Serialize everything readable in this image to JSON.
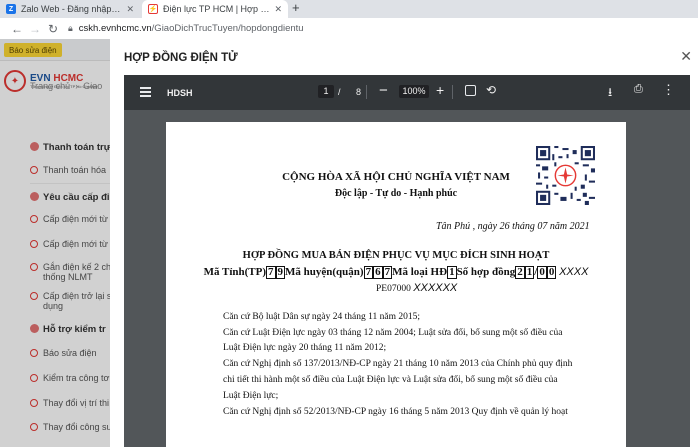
{
  "browser": {
    "tabs": [
      {
        "title": "Zalo Web - Đăng nhập Zalo",
        "icon": "zalo-icon"
      },
      {
        "title": "Điện lực TP HCM | Hợp đồng điện tử",
        "icon": "evn-icon"
      }
    ],
    "new_tab": "+",
    "url_host": "cskh.evnhcmc.vn",
    "url_path": "/GiaoDichTrucTuyen/hopdongdientu"
  },
  "site": {
    "report_label": "Báo sửa điện",
    "logo_text": "EVN",
    "logo_accent": "HCMC",
    "logo_subtitle": "Tổng công ty Điện lực TP Hồ Chí Minh",
    "breadcrumb_home": "Trang chủ",
    "breadcrumb_next": "Giao",
    "sidebar": [
      {
        "label": "Thanh toán trự",
        "type": "head"
      },
      {
        "label": "Thanh toán hóa",
        "type": "item"
      },
      {
        "label": "Yêu cầu cấp đi",
        "type": "head"
      },
      {
        "label": "Cấp điện mới từ",
        "type": "item"
      },
      {
        "label": "Cấp điện mới từ",
        "type": "item"
      },
      {
        "label": "Gắn điện kế 2 ch",
        "label2": "thống NLMT",
        "type": "item"
      },
      {
        "label": "Cấp điện trở lại s",
        "label2": "dụng",
        "type": "item"
      },
      {
        "label": "Hỗ trợ kiểm tr",
        "type": "head"
      },
      {
        "label": "Báo sửa điện",
        "type": "item"
      },
      {
        "label": "Kiểm tra công tơ",
        "type": "item"
      },
      {
        "label": "Thay đổi vị trí thi",
        "type": "item"
      },
      {
        "label": "Thay đổi công su",
        "type": "item"
      }
    ]
  },
  "modal": {
    "title": "HỢP ĐỒNG ĐIỆN TỬ",
    "close": "✕"
  },
  "viewer": {
    "file_name": "HDSH",
    "page_current": "1",
    "page_sep": "/",
    "page_total": "8",
    "zoom": "100%",
    "zoom_out": "−",
    "zoom_in": "+"
  },
  "document": {
    "national_title": "CỘNG HÒA XÃ HỘI CHỦ NGHĨA VIỆT NAM",
    "motto": "Độc lập - Tự do - Hạnh phúc",
    "place_date": "Tân Phú , ngày 26 tháng 07 năm 2021",
    "contract_title": "HỢP ĐỒNG MUA BÁN ĐIỆN PHỤC VỤ MỤC ĐÍCH SINH HOẠT",
    "code": {
      "label_province": "Mã Tỉnh(TP)",
      "province": [
        "7",
        "9"
      ],
      "label_district": "Mã huyện(quận)",
      "district": [
        "7",
        "6",
        "7"
      ],
      "label_type": "Mã loại HĐ",
      "type": [
        "1"
      ],
      "label_number": "Số hợp đồng",
      "number_a": [
        "2",
        "1"
      ],
      "slash": "/",
      "number_b": [
        "0",
        "0"
      ],
      "masked": "XXXX"
    },
    "pe_code": "PE07000",
    "pe_masked": "XXXXXX",
    "paragraphs": [
      "Căn cứ Bộ luật Dân sự ngày 24 tháng 11 năm 2015;",
      "Căn cứ Luật Điện lực ngày 03 tháng 12 năm 2004; Luật sửa đổi, bổ sung một số điều của",
      "Luật Điện lực ngày 20 tháng 11 năm 2012;",
      "Căn cứ Nghị định số 137/2013/NĐ-CP ngày 21 tháng 10 năm 2013 của Chính phủ quy định",
      "chi tiết thi hành một số điều của Luật Điện lực và Luật sửa đổi, bổ sung một số điều của",
      "Luật Điện lực;",
      "Căn cứ Nghị định số 52/2013/NĐ-CP ngày 16 tháng 5 năm 2013 Quy định về quản lý hoạt"
    ]
  }
}
